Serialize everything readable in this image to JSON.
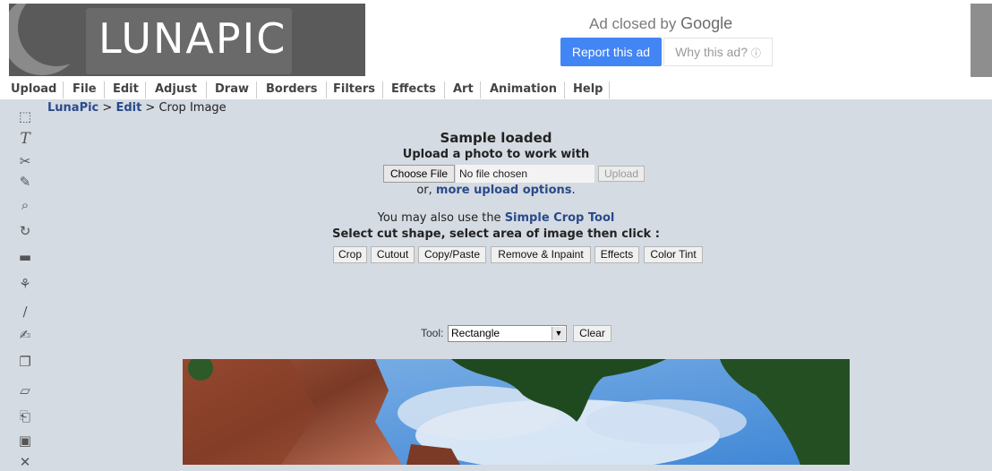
{
  "logo": {
    "text": "LUNAPIC"
  },
  "ad": {
    "closed_text": "Ad closed by",
    "closed_brand": "Google",
    "report_label": "Report this ad",
    "why_label": "Why this ad?",
    "why_icon": "ⓘ"
  },
  "menu": {
    "items": [
      "Upload",
      "File",
      "Edit",
      "Adjust",
      "Draw",
      "Borders",
      "Filters",
      "Effects",
      "Art",
      "Animation",
      "Help"
    ]
  },
  "toolbar": {
    "icons": [
      {
        "name": "select-icon",
        "glyph": "⬚"
      },
      {
        "name": "text-icon",
        "glyph": "T"
      },
      {
        "name": "scissors-icon",
        "glyph": "✂"
      },
      {
        "name": "pencil-icon",
        "glyph": "✎"
      },
      {
        "name": "zoom-icon",
        "glyph": "⌕"
      },
      {
        "name": "rotate-icon",
        "glyph": "↻"
      },
      {
        "name": "rectangle-icon",
        "glyph": "▬"
      },
      {
        "name": "paint-bucket-icon",
        "glyph": "⚘"
      },
      {
        "name": "eyedropper-icon",
        "glyph": "∕"
      },
      {
        "name": "brush-icon",
        "glyph": "✍"
      },
      {
        "name": "layers-icon",
        "glyph": "❐"
      },
      {
        "name": "eraser-icon",
        "glyph": "▱"
      },
      {
        "name": "open-folder-icon",
        "glyph": "⎗"
      },
      {
        "name": "save-icon",
        "glyph": "▣"
      },
      {
        "name": "close-icon",
        "glyph": "✕"
      }
    ]
  },
  "breadcrumb": {
    "root": "LunaPic",
    "sep1": " > ",
    "section": "Edit",
    "sep2": " > ",
    "current": "Crop Image"
  },
  "main": {
    "sample_loaded": "Sample loaded",
    "upload_prompt": "Upload a photo to work with",
    "choose_file_label": "Choose File",
    "no_file_text": "No file chosen",
    "upload_button": "Upload",
    "or_prefix": "or, ",
    "more_upload_link": "more upload options",
    "or_suffix": ".",
    "also_prefix": "You may also use the ",
    "simple_crop_link": "Simple Crop Tool",
    "select_instruction": "Select cut shape, select area of image then click :",
    "op_buttons": [
      "Crop",
      "Cutout",
      "Copy/Paste",
      "Remove & Inpaint",
      "Effects",
      "Color Tint"
    ],
    "tool_label": "Tool:",
    "tool_selected": "Rectangle",
    "clear_button": "Clear"
  },
  "colors": {
    "page_bg": "#d5dbe2",
    "link": "#2a4a8a",
    "ad_blue": "#4285f4"
  }
}
